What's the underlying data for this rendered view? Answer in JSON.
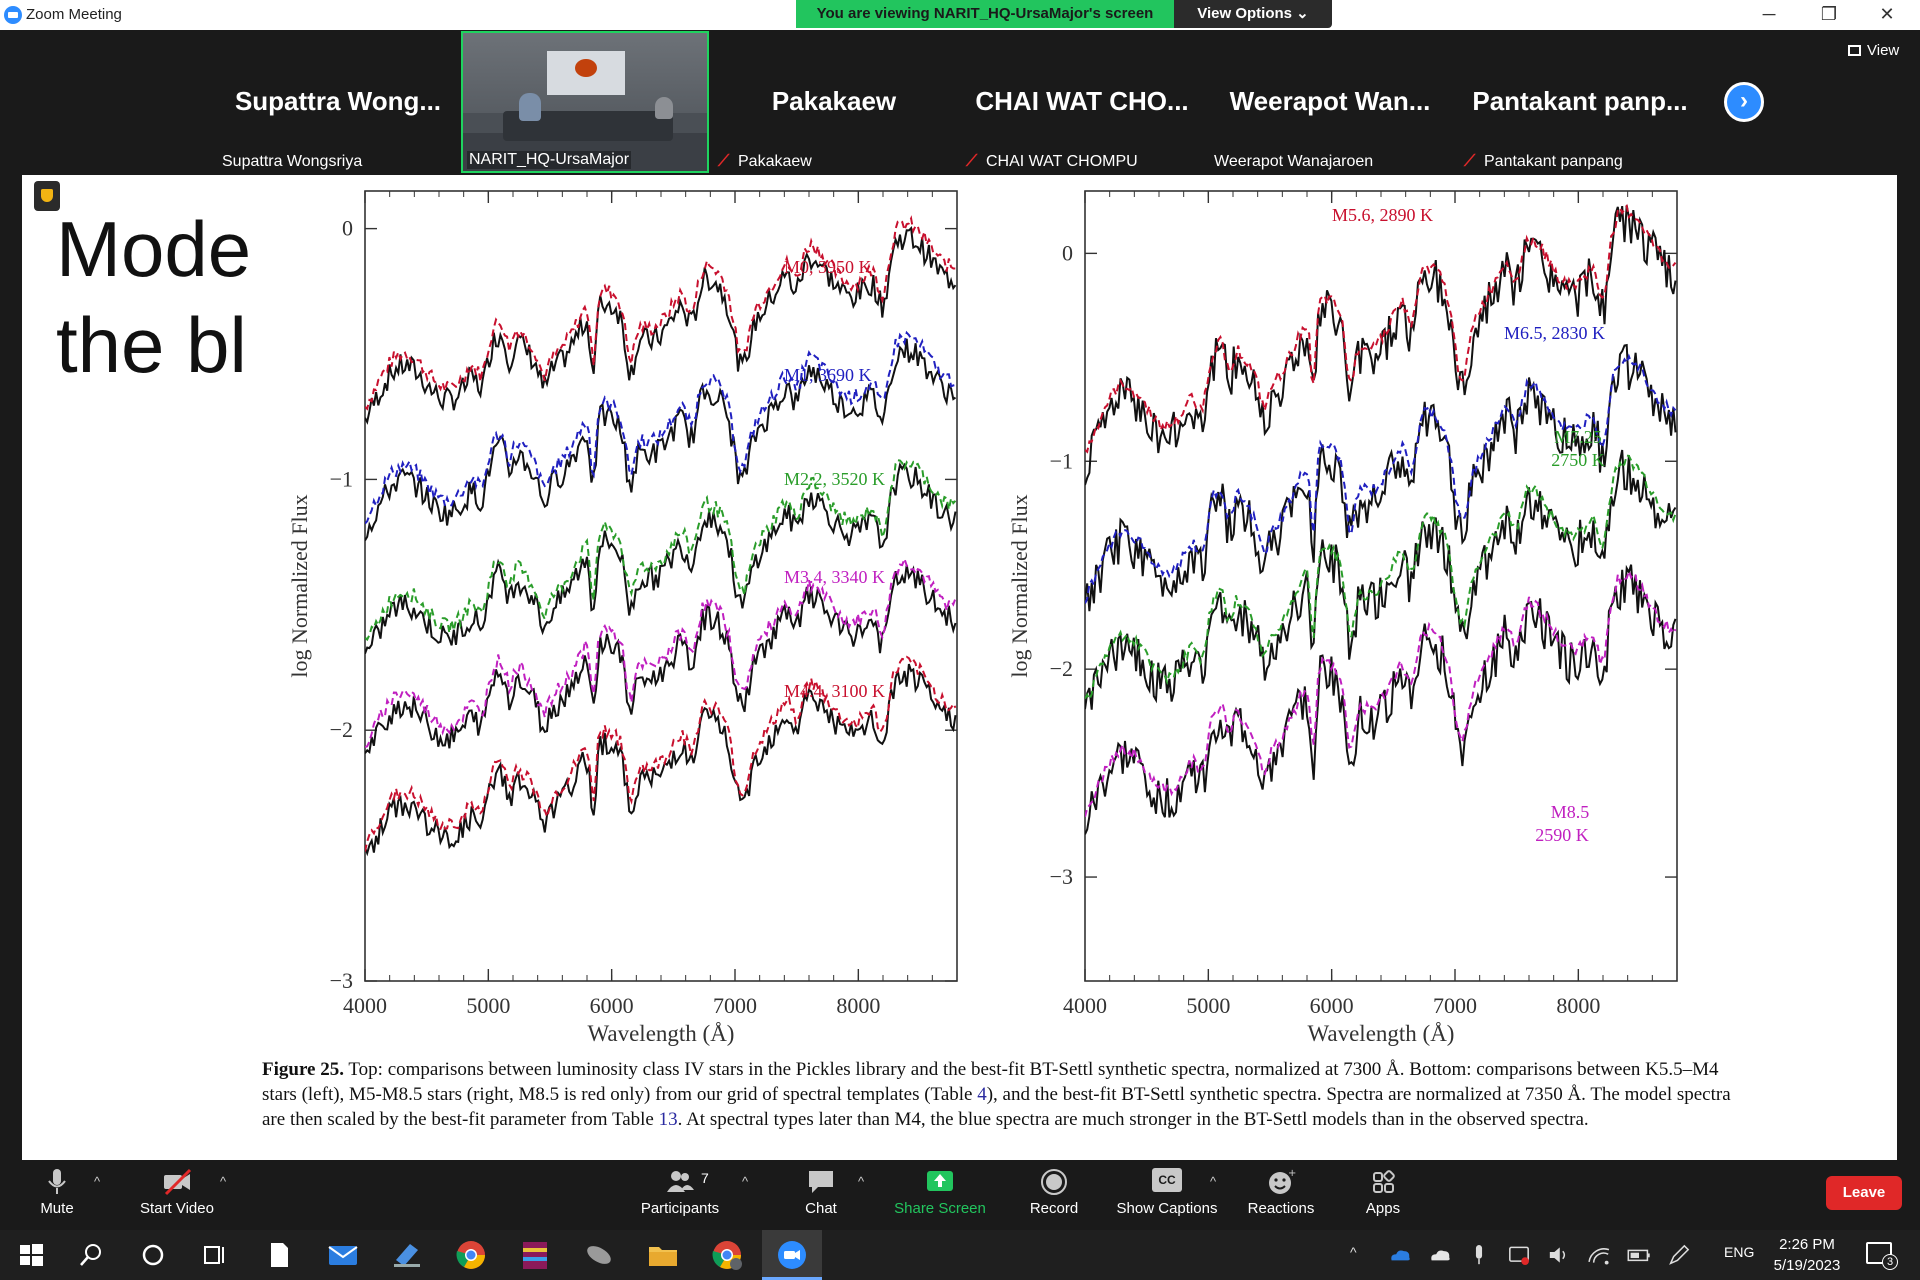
{
  "window": {
    "title": "Zoom Meeting",
    "banner": "You are viewing NARIT_HQ-UrsaMajor's screen",
    "view_options": "View Options ⌄",
    "minimize": "─",
    "restore": "❐",
    "close": "✕"
  },
  "participants": [
    {
      "big": "Supattra Wong...",
      "name": "Supattra Wongsriya",
      "muted": false
    },
    {
      "big": "",
      "name": "NARIT_HQ-UrsaMajor",
      "muted": false,
      "video": true
    },
    {
      "big": "Pakakaew",
      "name": "Pakakaew",
      "muted": true
    },
    {
      "big": "CHAI WAT CHO...",
      "name": "CHAI WAT CHOMPU",
      "muted": true
    },
    {
      "big": "Weerapot Wan...",
      "name": "Weerapot Wanajaroen",
      "muted": false
    },
    {
      "big": "Pantakant panp...",
      "name": "Pantakant panpang",
      "muted": true
    }
  ],
  "view_button": "View",
  "slide": {
    "title_line1": "Mode",
    "title_line2": "the bl"
  },
  "chart_data": [
    {
      "type": "line",
      "xlabel": "Wavelength (Å)",
      "ylabel": "log Normalized Flux",
      "xlim": [
        4000,
        8800
      ],
      "ylim": [
        -3,
        0.15
      ],
      "xticks": [
        4000,
        5000,
        6000,
        7000,
        8000
      ],
      "yticks": [
        0,
        -1,
        -2,
        -3
      ],
      "series": [
        {
          "name": "M0, 3950 K",
          "color": "#c8102e",
          "offset": 0.0
        },
        {
          "name": "M1, 3690 K",
          "color": "#2020c0",
          "offset": -0.45
        },
        {
          "name": "M2.2, 3520 K",
          "color": "#2a9d2a",
          "offset": -0.95
        },
        {
          "name": "M3.4, 3340 K",
          "color": "#c020c0",
          "offset": -1.35
        },
        {
          "name": "M4.4, 3100 K",
          "color": "#c8102e",
          "offset": -1.75
        }
      ]
    },
    {
      "type": "line",
      "xlabel": "Wavelength (Å)",
      "ylabel": "log Normalized Flux",
      "xlim": [
        4000,
        8800
      ],
      "ylim": [
        -3.5,
        0.3
      ],
      "xticks": [
        4000,
        5000,
        6000,
        7000,
        8000
      ],
      "yticks": [
        0,
        -1,
        -2,
        -3
      ],
      "series": [
        {
          "name": "M5.6, 2890 K",
          "color": "#c8102e",
          "offset": 0.0
        },
        {
          "name": "M6.5, 2830 K",
          "color": "#2020c0",
          "offset": -0.7
        },
        {
          "name": "M7.25 2750 K",
          "color": "#2a9d2a",
          "offset": -1.2
        },
        {
          "name": "M8.5 2590 K",
          "color": "#c020c0",
          "offset": -1.75
        }
      ]
    }
  ],
  "plot_labels": {
    "left": {
      "x_tick_labels": [
        "4000",
        "5000",
        "6000",
        "7000",
        "8000"
      ],
      "y_tick_labels": [
        "0",
        "−1",
        "−2",
        "−3"
      ],
      "xlabel": "Wavelength (Å)",
      "ylabel": "log Normalized Flux",
      "series_labels": [
        "M0, 3950 K",
        "M1, 3690 K",
        "M2.2, 3520 K",
        "M3.4, 3340 K",
        "M4.4, 3100 K"
      ]
    },
    "right": {
      "x_tick_labels": [
        "4000",
        "5000",
        "6000",
        "7000",
        "8000"
      ],
      "y_tick_labels": [
        "0",
        "−1",
        "−2",
        "−3"
      ],
      "xlabel": "Wavelength (Å)",
      "ylabel": "log Normalized Flux",
      "series_labels": [
        "M5.6, 2890 K",
        "M6.5, 2830 K",
        "M7.25",
        "2750 K",
        "M8.5",
        "2590 K"
      ]
    }
  },
  "caption": {
    "fig": "Figure 25.",
    "text1": " Top: comparisons between luminosity class IV stars in the Pickles library and the best-fit BT-Settl synthetic spectra, normalized at 7300 Å. Bottom: comparisons between K5.5–M4 stars (left), M5-M8.5 stars (right, M8.5 is red only) from our grid of spectral templates (Table ",
    "link1": "4",
    "text2": "), and the best-fit BT-Settl synthetic spectra. Spectra are normalized at 7350 Å. The model spectra are then scaled by the best-fit parameter from Table ",
    "link2": "13",
    "text3": ". At spectral types later than M4, the blue spectra are much stronger in the BT-Settl models than in the observed spectra."
  },
  "toolbar": {
    "mute": "Mute",
    "start_video": "Start Video",
    "participants": "Participants",
    "participants_count": "7",
    "chat": "Chat",
    "share_screen": "Share Screen",
    "record": "Record",
    "show_captions": "Show Captions",
    "reactions": "Reactions",
    "apps": "Apps",
    "leave": "Leave",
    "cc": "CC"
  },
  "taskbar": {
    "lang": "ENG",
    "time": "2:26 PM",
    "date": "5/19/2023",
    "notifications": "3"
  },
  "colors": {
    "accent": "#2d8cff",
    "share_green": "#22c55e",
    "leave_red": "#e02828"
  }
}
